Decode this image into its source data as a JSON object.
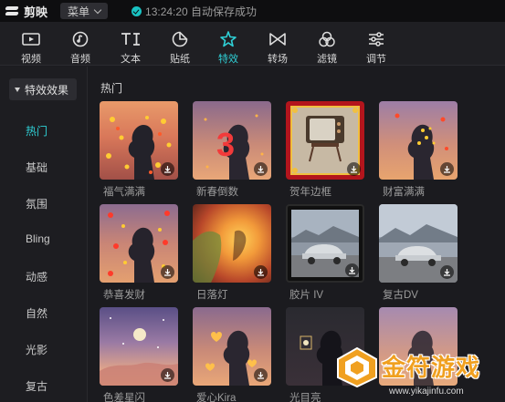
{
  "app": {
    "name": "剪映",
    "menu_label": "菜单",
    "save_status": "13:24:20 自动保存成功"
  },
  "toolbar": {
    "items": [
      {
        "label": "视频",
        "icon": "video-icon"
      },
      {
        "label": "音频",
        "icon": "audio-icon"
      },
      {
        "label": "文本",
        "icon": "text-icon"
      },
      {
        "label": "贴纸",
        "icon": "sticker-icon"
      },
      {
        "label": "特效",
        "icon": "effects-icon",
        "active": true
      },
      {
        "label": "转场",
        "icon": "transition-icon"
      },
      {
        "label": "滤镜",
        "icon": "filter-icon"
      },
      {
        "label": "调节",
        "icon": "adjust-icon"
      }
    ],
    "accent": "#2fd0d6"
  },
  "sidebar": {
    "header": "特效效果",
    "items": [
      {
        "label": "热门",
        "active": true
      },
      {
        "label": "基础"
      },
      {
        "label": "氛围"
      },
      {
        "label": "Bling"
      },
      {
        "label": "动感"
      },
      {
        "label": "自然"
      },
      {
        "label": "光影"
      },
      {
        "label": "复古"
      }
    ]
  },
  "main": {
    "section_title": "热门",
    "cards": [
      {
        "label": "福气满满"
      },
      {
        "label": "新春倒数"
      },
      {
        "label": "贺年边框"
      },
      {
        "label": "财富满满"
      },
      {
        "label": "恭喜发财"
      },
      {
        "label": "日落灯"
      },
      {
        "label": "胶片 IV"
      },
      {
        "label": "复古DV"
      },
      {
        "label": "色差星闪"
      },
      {
        "label": "爱心Kira"
      },
      {
        "label": "光目亮"
      },
      {
        "label": ""
      }
    ]
  },
  "watermark": {
    "text": "金符游戏",
    "url": "www.yikajinfu.com"
  }
}
